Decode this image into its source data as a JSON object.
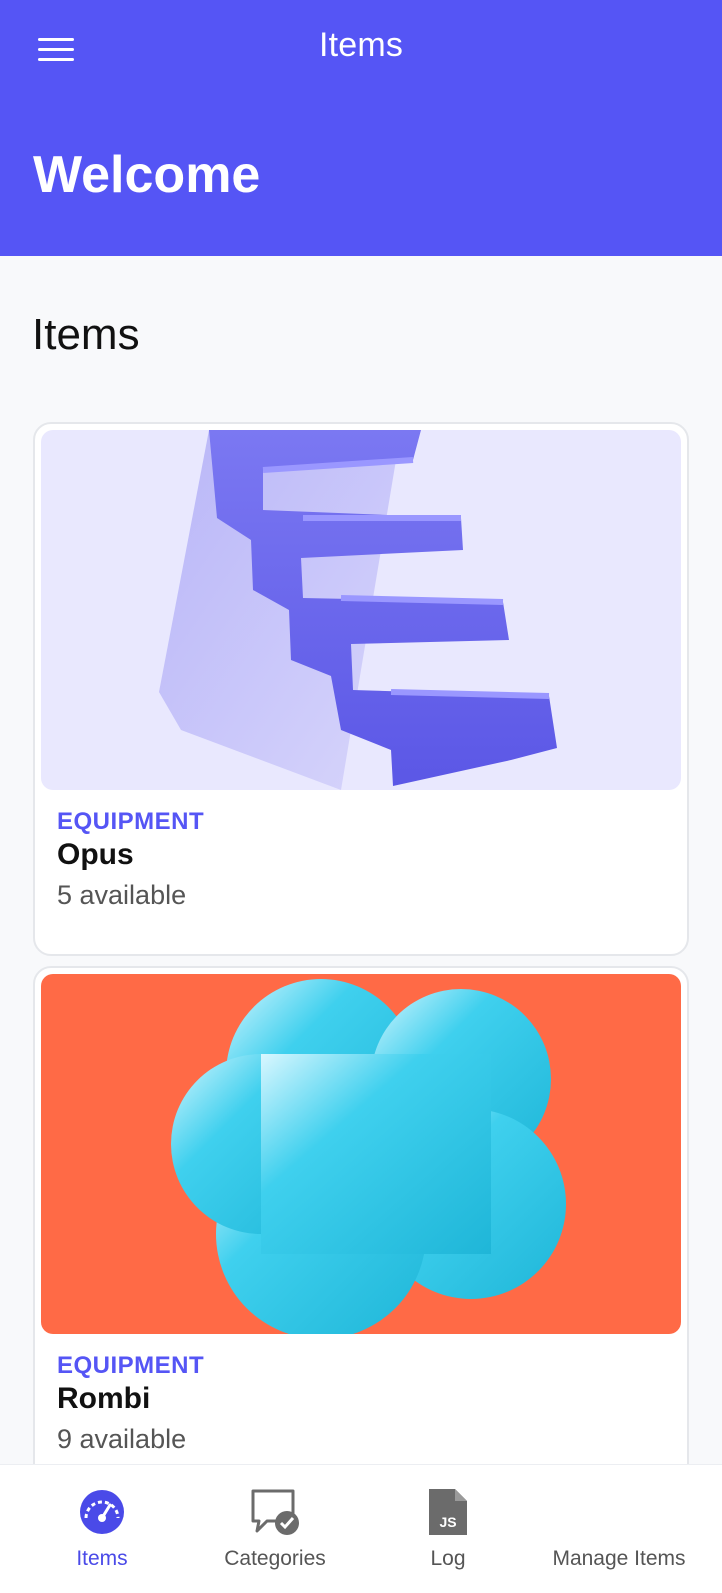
{
  "header": {
    "title": "Items",
    "welcome": "Welcome"
  },
  "main": {
    "section_title": "Items",
    "items": [
      {
        "category": "EQUIPMENT",
        "name": "Opus",
        "availability": "5 available"
      },
      {
        "category": "EQUIPMENT",
        "name": "Rombi",
        "availability": "9 available"
      }
    ]
  },
  "tabbar": {
    "tabs": [
      {
        "label": "Items",
        "icon": "dashboard-gauge-icon",
        "active": true
      },
      {
        "label": "Categories",
        "icon": "chat-check-icon",
        "active": false
      },
      {
        "label": "Log",
        "icon": "js-file-icon",
        "active": false
      },
      {
        "label": "Manage Items",
        "icon": "none",
        "active": false
      }
    ]
  },
  "colors": {
    "accent": "#5555f5",
    "card1_bg": "#e9e8fe",
    "card2_bg": "#ff6a46",
    "shape2": "#2ec6e4"
  }
}
